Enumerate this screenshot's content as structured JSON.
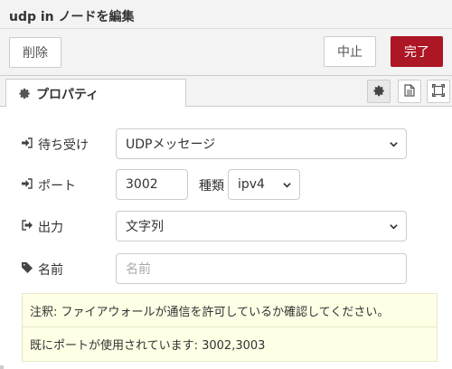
{
  "header": {
    "title": "udp in ノードを編集"
  },
  "toolbar": {
    "delete_label": "削除",
    "cancel_label": "中止",
    "done_label": "完了"
  },
  "tabs": {
    "properties_label": "プロパティ"
  },
  "form": {
    "listen": {
      "label": "待ち受け",
      "value": "UDPメッセージ"
    },
    "port": {
      "label": "ポート",
      "value": "3002",
      "type_label": "種類",
      "type_value": "ipv4"
    },
    "output": {
      "label": "出力",
      "value": "文字列"
    },
    "name": {
      "label": "名前",
      "placeholder": "名前"
    }
  },
  "tips": {
    "firewall_note": "注釈: ファイアウォールが通信を許可しているか確認してください。",
    "ports_in_use": "既にポートが使用されています: 3002,3003"
  },
  "colors": {
    "accent": "#ad1625",
    "tip_background": "#ffffe6",
    "panel_background": "#f3f3f3"
  }
}
